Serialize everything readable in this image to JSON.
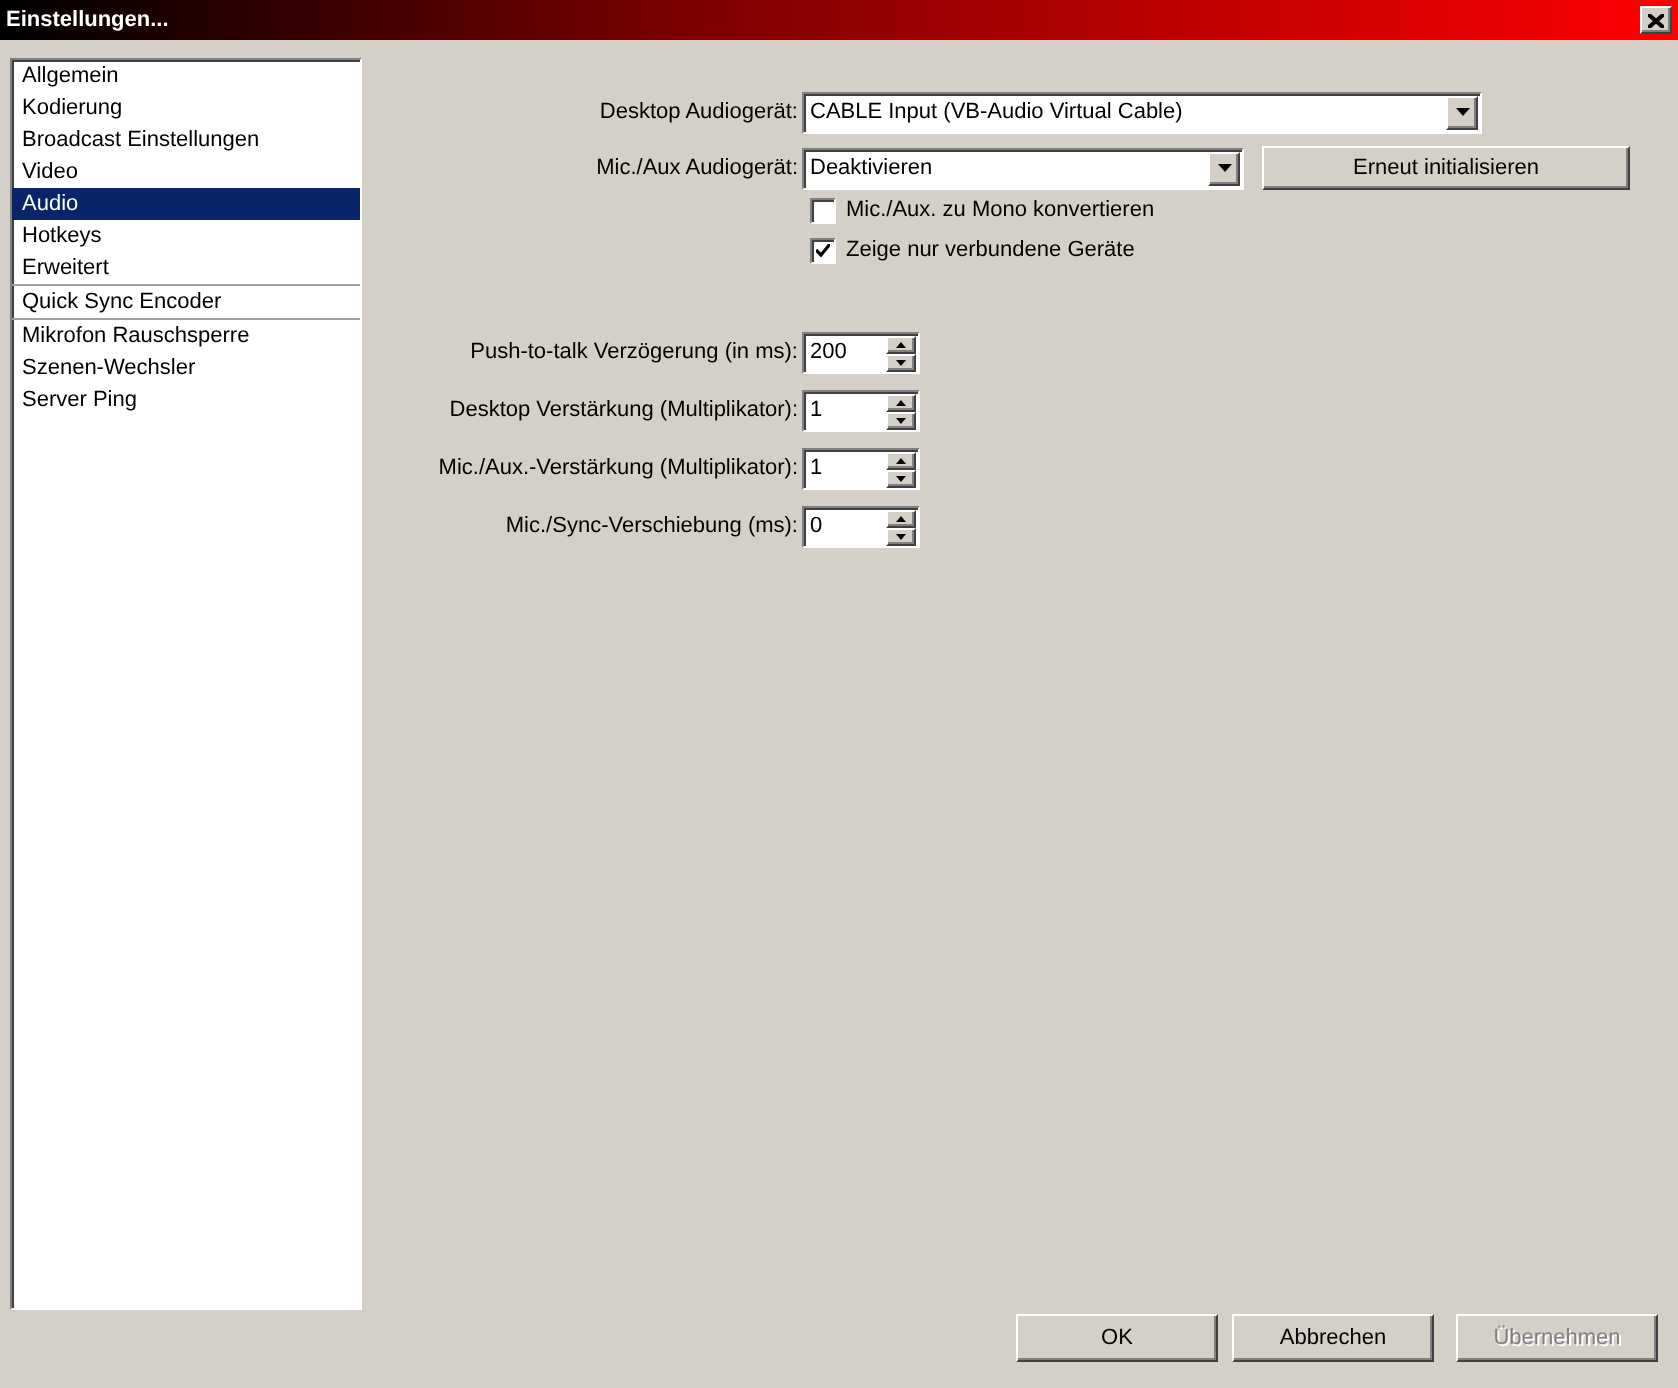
{
  "window": {
    "title": "Einstellungen..."
  },
  "sidebar": {
    "groups": [
      [
        {
          "label": "Allgemein",
          "selected": false
        },
        {
          "label": "Kodierung",
          "selected": false
        },
        {
          "label": "Broadcast Einstellungen",
          "selected": false
        },
        {
          "label": "Video",
          "selected": false
        },
        {
          "label": "Audio",
          "selected": true
        },
        {
          "label": "Hotkeys",
          "selected": false
        },
        {
          "label": "Erweitert",
          "selected": false
        }
      ],
      [
        {
          "label": "Quick Sync Encoder",
          "selected": false
        }
      ],
      [
        {
          "label": "Mikrofon Rauschsperre",
          "selected": false
        },
        {
          "label": "Szenen-Wechsler",
          "selected": false
        },
        {
          "label": "Server Ping",
          "selected": false
        }
      ]
    ]
  },
  "devices": {
    "desktop": {
      "label": "Desktop Audiogerät:",
      "value": "CABLE Input (VB-Audio Virtual Cable)"
    },
    "mic": {
      "label": "Mic./Aux Audiogerät:",
      "value": "Deaktivieren"
    },
    "reinit_button": "Erneut initialisieren",
    "checkboxes": [
      {
        "label": "Mic./Aux. zu Mono konvertieren",
        "checked": false
      },
      {
        "label": "Zeige nur verbundene Geräte",
        "checked": true
      }
    ]
  },
  "spinners": [
    {
      "label": "Push-to-talk Verzögerung (in ms):",
      "value": "200"
    },
    {
      "label": "Desktop Verstärkung (Multiplikator):",
      "value": "1"
    },
    {
      "label": "Mic./Aux.-Verstärkung (Multiplikator):",
      "value": "1"
    },
    {
      "label": "Mic./Sync-Verschiebung (ms):",
      "value": "0"
    }
  ],
  "buttons": [
    {
      "label": "OK",
      "disabled": false
    },
    {
      "label": "Abbrechen",
      "disabled": false
    },
    {
      "label": "Übernehmen",
      "disabled": true
    }
  ]
}
